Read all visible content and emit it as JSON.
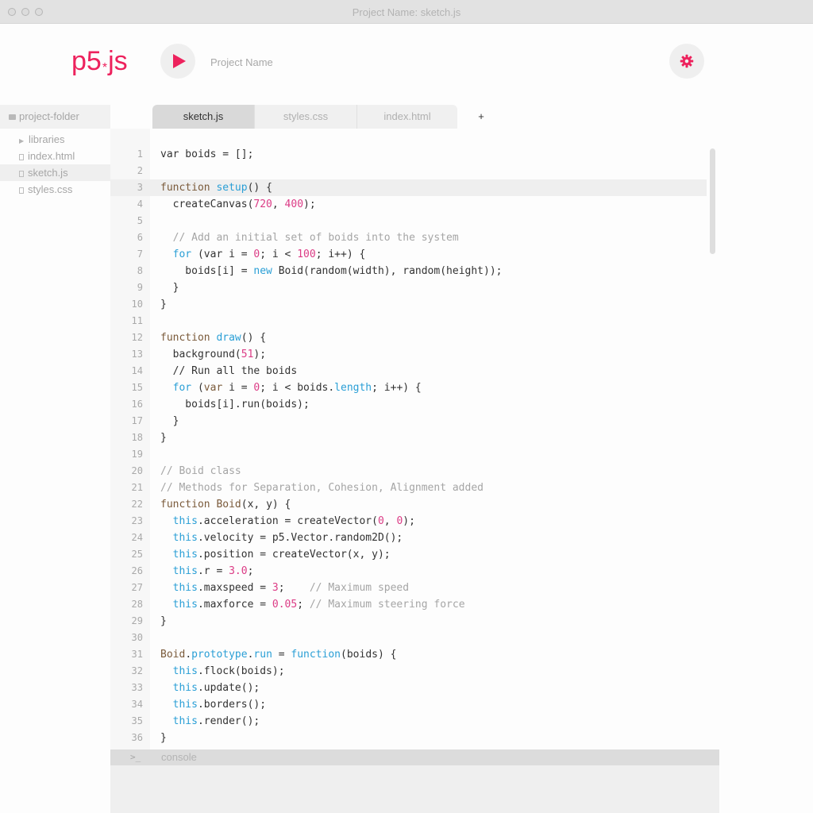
{
  "window": {
    "title": "Project Name: sketch.js"
  },
  "toolbar": {
    "logo": "p5",
    "logo_star": "*",
    "logo_suffix": "js",
    "project_name": "Project Name"
  },
  "colors": {
    "accent": "#ed225d",
    "keyword": "#7a5a3a",
    "function": "#2a9fd6",
    "number": "#dc3c86",
    "comment": "#a5a5a5"
  },
  "sidebar": {
    "folder": "project-folder",
    "items": [
      {
        "label": "libraries",
        "icon": "triangle-right-icon"
      },
      {
        "label": "index.html",
        "icon": "file-icon"
      },
      {
        "label": "sketch.js",
        "icon": "file-icon"
      },
      {
        "label": "styles.css",
        "icon": "file-icon"
      }
    ]
  },
  "tabs": [
    {
      "label": "sketch.js"
    },
    {
      "label": "styles.css"
    },
    {
      "label": "index.html"
    }
  ],
  "tab_add": "+",
  "editor": {
    "lines": [
      [
        [
          "t",
          "var boids = [];"
        ]
      ],
      [],
      [
        [
          "kw",
          "function "
        ],
        [
          "fn",
          "setup"
        ],
        [
          "t",
          "() {"
        ]
      ],
      [
        [
          "t",
          "  createCanvas("
        ],
        [
          "num",
          "720"
        ],
        [
          "t",
          ", "
        ],
        [
          "num",
          "400"
        ],
        [
          "t",
          ");"
        ]
      ],
      [],
      [
        [
          "cm",
          "  // Add an initial set of boids into the system"
        ]
      ],
      [
        [
          "fn",
          "  for"
        ],
        [
          "t",
          " (var i = "
        ],
        [
          "num",
          "0"
        ],
        [
          "t",
          "; i < "
        ],
        [
          "num",
          "100"
        ],
        [
          "t",
          "; i++) {"
        ]
      ],
      [
        [
          "t",
          "    boids[i] = "
        ],
        [
          "fn",
          "new"
        ],
        [
          "t",
          " Boid(random(width), random(height));"
        ]
      ],
      [
        [
          "t",
          "  }"
        ]
      ],
      [
        [
          "t",
          "}"
        ]
      ],
      [],
      [
        [
          "kw",
          "function "
        ],
        [
          "fn",
          "draw"
        ],
        [
          "t",
          "() {"
        ]
      ],
      [
        [
          "t",
          "  background("
        ],
        [
          "num",
          "51"
        ],
        [
          "t",
          ");"
        ]
      ],
      [
        [
          "t",
          "  // Run all the boids"
        ]
      ],
      [
        [
          "fn",
          "  for"
        ],
        [
          "t",
          " ("
        ],
        [
          "kw",
          "var"
        ],
        [
          "t",
          " i = "
        ],
        [
          "num",
          "0"
        ],
        [
          "t",
          "; i < boids."
        ],
        [
          "fn",
          "length"
        ],
        [
          "t",
          "; i++) {"
        ]
      ],
      [
        [
          "t",
          "    boids[i].run(boids);"
        ]
      ],
      [
        [
          "t",
          "  }"
        ]
      ],
      [
        [
          "t",
          "}"
        ]
      ],
      [],
      [
        [
          "cm",
          "// Boid class"
        ]
      ],
      [
        [
          "cm",
          "// Methods for Separation, Cohesion, Alignment added"
        ]
      ],
      [
        [
          "kw",
          "function "
        ],
        [
          "kw",
          "Boid"
        ],
        [
          "t",
          "(x, y) {"
        ]
      ],
      [
        [
          "fn",
          "  this"
        ],
        [
          "t",
          ".acceleration = createVector("
        ],
        [
          "num",
          "0"
        ],
        [
          "t",
          ", "
        ],
        [
          "num",
          "0"
        ],
        [
          "t",
          ");"
        ]
      ],
      [
        [
          "fn",
          "  this"
        ],
        [
          "t",
          ".velocity = p5.Vector.random2D();"
        ]
      ],
      [
        [
          "fn",
          "  this"
        ],
        [
          "t",
          ".position = createVector(x, y);"
        ]
      ],
      [
        [
          "fn",
          "  this"
        ],
        [
          "t",
          ".r = "
        ],
        [
          "num",
          "3.0"
        ],
        [
          "t",
          ";"
        ]
      ],
      [
        [
          "fn",
          "  this"
        ],
        [
          "t",
          ".maxspeed = "
        ],
        [
          "num",
          "3"
        ],
        [
          "t",
          ";    "
        ],
        [
          "cm",
          "// Maximum speed"
        ]
      ],
      [
        [
          "fn",
          "  this"
        ],
        [
          "t",
          ".maxforce = "
        ],
        [
          "num",
          "0.05"
        ],
        [
          "t",
          "; "
        ],
        [
          "cm",
          "// Maximum steering force"
        ]
      ],
      [
        [
          "t",
          "}"
        ]
      ],
      [],
      [
        [
          "kw",
          "Boid"
        ],
        [
          "t",
          "."
        ],
        [
          "fn",
          "prototype"
        ],
        [
          "t",
          "."
        ],
        [
          "fn",
          "run"
        ],
        [
          "t",
          " = "
        ],
        [
          "fn",
          "function"
        ],
        [
          "t",
          "(boids) {"
        ]
      ],
      [
        [
          "fn",
          "  this"
        ],
        [
          "t",
          ".flock(boids);"
        ]
      ],
      [
        [
          "fn",
          "  this"
        ],
        [
          "t",
          ".update();"
        ]
      ],
      [
        [
          "fn",
          "  this"
        ],
        [
          "t",
          ".borders();"
        ]
      ],
      [
        [
          "fn",
          "  this"
        ],
        [
          "t",
          ".render();"
        ]
      ],
      [
        [
          "t",
          "}"
        ]
      ]
    ],
    "highlighted_line": 3
  },
  "console": {
    "prompt": ">_",
    "label": "console"
  }
}
